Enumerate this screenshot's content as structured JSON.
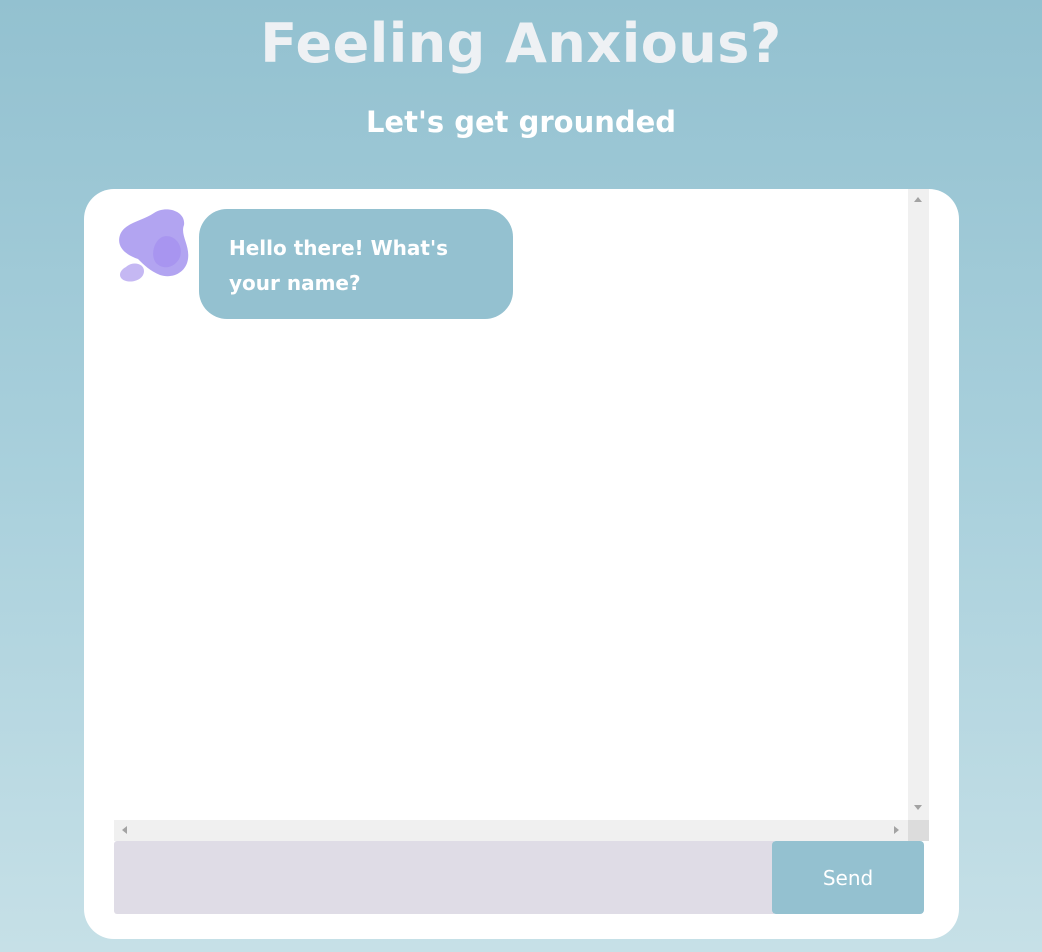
{
  "header": {
    "title": "Feeling Anxious?",
    "subtitle": "Let's get grounded"
  },
  "chat": {
    "messages": [
      {
        "sender": "bot",
        "text": "Hello there! What's your name?"
      }
    ],
    "input": {
      "value": "",
      "placeholder": ""
    },
    "send_label": "Send"
  },
  "colors": {
    "background_top": "#93c1d0",
    "background_bottom": "#c6e0e7",
    "bubble": "#94c1d0",
    "input": "#dfdce6",
    "send_button": "#94c1d0",
    "avatar": "#ae9ff0"
  },
  "icons": {
    "avatar": "purple-blob-avatar-icon"
  }
}
